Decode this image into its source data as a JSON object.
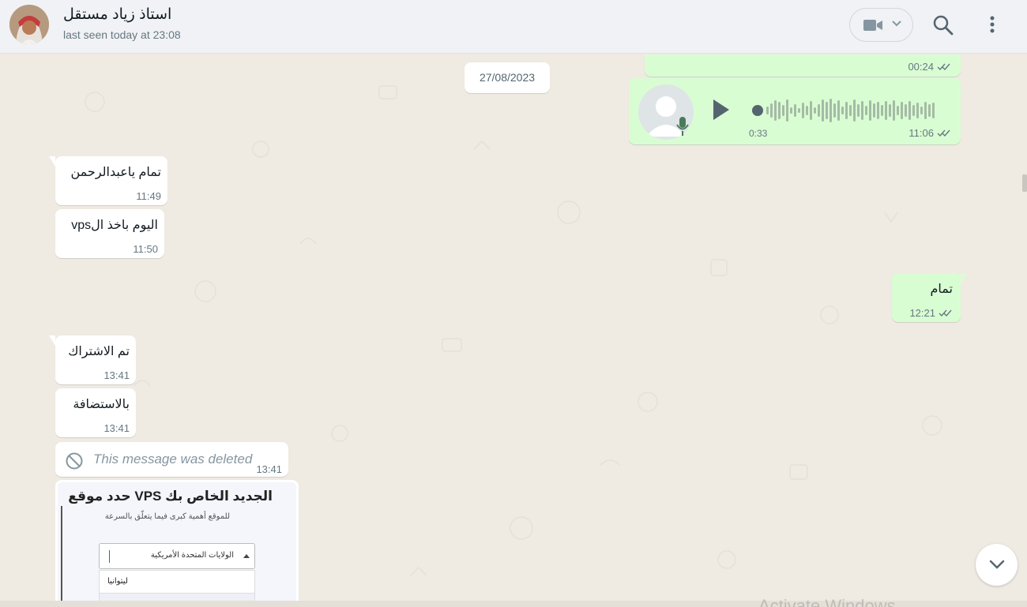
{
  "header": {
    "contact_name": "استاذ زياد مستقل",
    "status": "last seen today at 23:08"
  },
  "date_chip": "27/08/2023",
  "messages": [
    {
      "direction": "out",
      "kind": "text",
      "text": "",
      "time": "00:24",
      "ticks": "read"
    },
    {
      "direction": "out",
      "kind": "voice",
      "duration": "0:33",
      "time": "11:06",
      "ticks": "read"
    },
    {
      "direction": "in",
      "kind": "text",
      "text": "تمام ياعبدالرحمن",
      "time": "11:49"
    },
    {
      "direction": "in",
      "kind": "text",
      "text": "اليوم باخذ الvps",
      "time": "11:50"
    },
    {
      "direction": "out",
      "kind": "text",
      "text": "تمام",
      "time": "12:21",
      "ticks": "read"
    },
    {
      "direction": "in",
      "kind": "text",
      "text": "تم الاشتراك",
      "time": "13:41"
    },
    {
      "direction": "in",
      "kind": "text",
      "text": "بالاستضافة",
      "time": "13:41"
    },
    {
      "direction": "in",
      "kind": "deleted",
      "text": "This message was deleted",
      "time": "13:41"
    },
    {
      "direction": "in",
      "kind": "image",
      "image": {
        "title": "الجديد الخاص بك VPS حدد موقع",
        "subtitle": "للموقع أهمية كبرى فيما يتعلّق بالسرعة",
        "select_value": "الولايات المتحدة الأمريكية",
        "option": "ليتوانيا"
      }
    }
  ],
  "icons": {
    "video": "video-camera-icon",
    "chevron": "chevron-down-icon",
    "search": "search-icon",
    "menu": "more-vertical-icon",
    "play": "play-icon",
    "mic": "microphone-icon",
    "deleted": "blocked-icon",
    "scroll_down": "chevron-down-icon",
    "ticks": "double-check-icon"
  },
  "colors": {
    "outgoing_bubble": "#d9fdd3",
    "incoming_bubble": "#ffffff",
    "chat_background": "#efeae2",
    "header_background": "#f0f2f5",
    "read_ticks": "#667781"
  },
  "watermark": "Activate Windows"
}
